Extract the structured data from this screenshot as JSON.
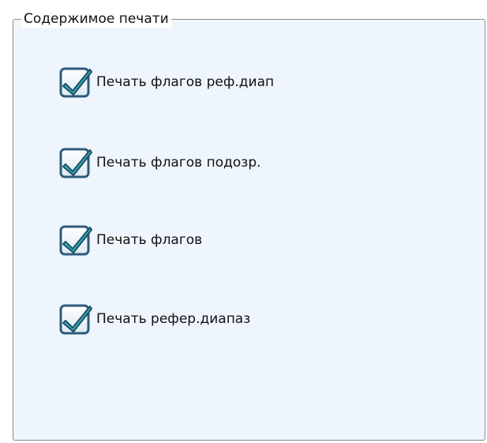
{
  "groupbox": {
    "title": "Содержимое печати"
  },
  "options": [
    {
      "label": "Печать флагов реф.диап",
      "checked": true
    },
    {
      "label": "Печать флагов подозр.",
      "checked": true
    },
    {
      "label": "Печать флагов",
      "checked": true
    },
    {
      "label": "Печать рефер.диапаз",
      "checked": true
    }
  ],
  "colors": {
    "panel_background": "#eef5fd",
    "checkbox_border": "#2e5a7a",
    "checkmark": "#2ab0b8"
  }
}
